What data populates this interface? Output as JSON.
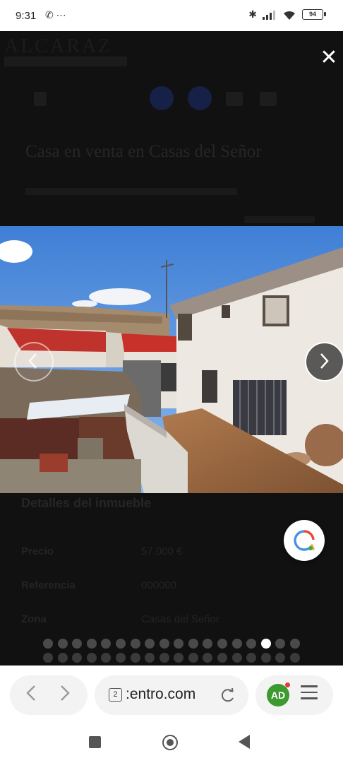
{
  "status_bar": {
    "time": "9:31",
    "left_icons": [
      "whatsapp-icon",
      "more-icon"
    ],
    "right_icons": [
      "bluetooth-icon",
      "signal-icon",
      "wifi-icon"
    ],
    "battery": "94"
  },
  "background_page": {
    "logo": "ALCARAZ",
    "title": "Casa en venta en Casas del Señor",
    "price": "57.000 €",
    "details_heading": "Detalles del inmueble",
    "rows": [
      {
        "label": "Precio",
        "value": "57.000 €"
      },
      {
        "label": "Referencia",
        "value": "000000"
      },
      {
        "label": "Zona",
        "value": "Casas del Señor"
      }
    ]
  },
  "viewer": {
    "close_icon": "close-icon",
    "prev_icon": "chevron-left-icon",
    "next_icon": "chevron-right-icon",
    "lens_icon": "lens-search-icon",
    "gallery": {
      "total_images": 18,
      "current_index": 15
    }
  },
  "browser": {
    "tab_count": "2",
    "url": ":entro.com",
    "back_icon": "chevron-left-icon",
    "forward_icon": "chevron-right-icon",
    "reload_icon": "reload-icon",
    "extension_label": "AD",
    "menu_icon": "hamburger-icon"
  },
  "system_nav": {
    "recent_icon": "recent-apps-icon",
    "home_icon": "home-icon",
    "back_icon": "back-icon"
  }
}
